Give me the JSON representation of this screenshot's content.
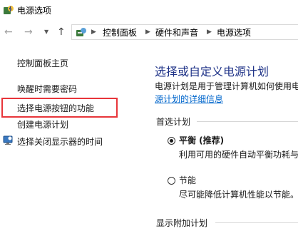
{
  "window": {
    "title": "电源选项",
    "icon": "power-options-icon"
  },
  "nav": {
    "back_icon": "back-arrow-icon",
    "forward_icon": "forward-arrow-icon",
    "recent_icon": "chevron-down-icon",
    "up_icon": "up-arrow-icon",
    "breadcrumb": [
      "控制面板",
      "硬件和声音",
      "电源选项"
    ],
    "separator": "▶"
  },
  "sidebar": {
    "items": [
      {
        "label": "控制面板主页"
      },
      {
        "label": "唤醒时需要密码"
      },
      {
        "label": "选择电源按钮的功能"
      },
      {
        "label": "创建电源计划"
      },
      {
        "label": "选择关闭显示器的时间"
      }
    ]
  },
  "main": {
    "title": "选择或自定义电源计划",
    "description_line1": "电源计划是用于管理计算机如何使用电",
    "description_link": "源计划的详细信息",
    "preferred_heading": "首选计划",
    "plans": [
      {
        "name": "平衡 (推荐)",
        "description": "利用可用的硬件自动平衡功耗与",
        "selected": true
      },
      {
        "name": "节能",
        "description": "尽可能降低计算机性能以节能。",
        "selected": false
      }
    ],
    "more_heading": "显示附加计划"
  },
  "colors": {
    "title_blue": "#1e3287",
    "link_blue": "#0066cc",
    "highlight_red": "#e8353a"
  }
}
